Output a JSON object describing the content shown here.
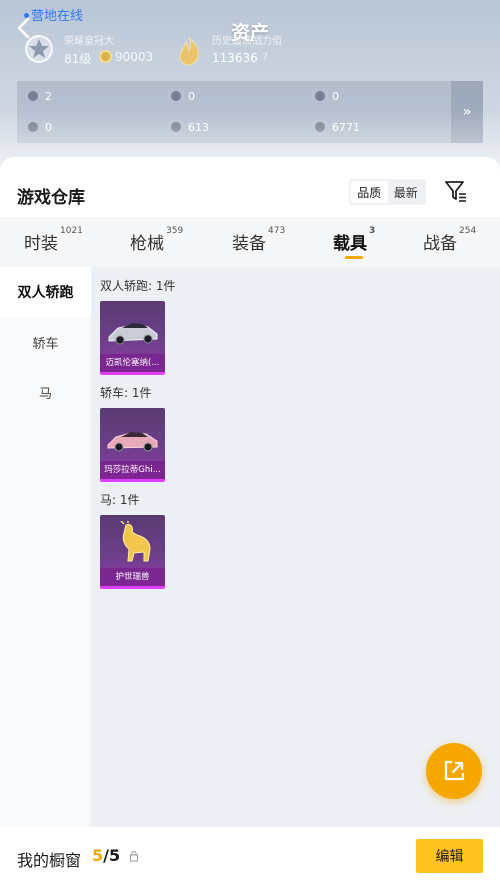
{
  "header": {
    "title": "资产",
    "online_status": "营地在线",
    "rank_caption": "荣耀皇冠大",
    "level": "81级",
    "coins": "90003",
    "power_caption": "历史最高战力值",
    "power_value": "113636",
    "power_help": "?"
  },
  "stats": [
    {
      "value": "2"
    },
    {
      "value": "0"
    },
    {
      "value": "0"
    },
    {
      "value": "0"
    },
    {
      "value": "613"
    },
    {
      "value": "6771"
    }
  ],
  "stats_more": "»",
  "warehouse": {
    "title": "游戏仓库",
    "sort": {
      "quality": "品质",
      "latest": "最新"
    }
  },
  "tabs": [
    {
      "label": "时装",
      "count": "1021"
    },
    {
      "label": "枪械",
      "count": "359"
    },
    {
      "label": "装备",
      "count": "473"
    },
    {
      "label": "载具",
      "count": "3"
    },
    {
      "label": "战备",
      "count": "254"
    }
  ],
  "sidebar": {
    "items": [
      {
        "label": "双人轿跑"
      },
      {
        "label": "轿车"
      },
      {
        "label": "马"
      }
    ]
  },
  "groups": [
    {
      "title": "双人轿跑: 1件",
      "item_name": "迈凯伦塞纳(..."
    },
    {
      "title": "轿车: 1件",
      "item_name": "玛莎拉蒂Ghi..."
    },
    {
      "title": "马: 1件",
      "item_name": "护世瑞兽"
    }
  ],
  "bottom": {
    "window_label": "我的橱窗",
    "window_current": "5",
    "window_total": "/5",
    "edit_label": "编辑"
  },
  "colors": {
    "accent": "#f5a800",
    "edit_button": "#ffc21f",
    "card_purple": "#6c3f8a",
    "card_border": "#e040fb"
  },
  "icons": [
    "back-arrow-icon",
    "rank-emblem-icon",
    "coin-icon",
    "power-flame-icon",
    "filter-icon",
    "share-export-icon",
    "lock-icon"
  ]
}
